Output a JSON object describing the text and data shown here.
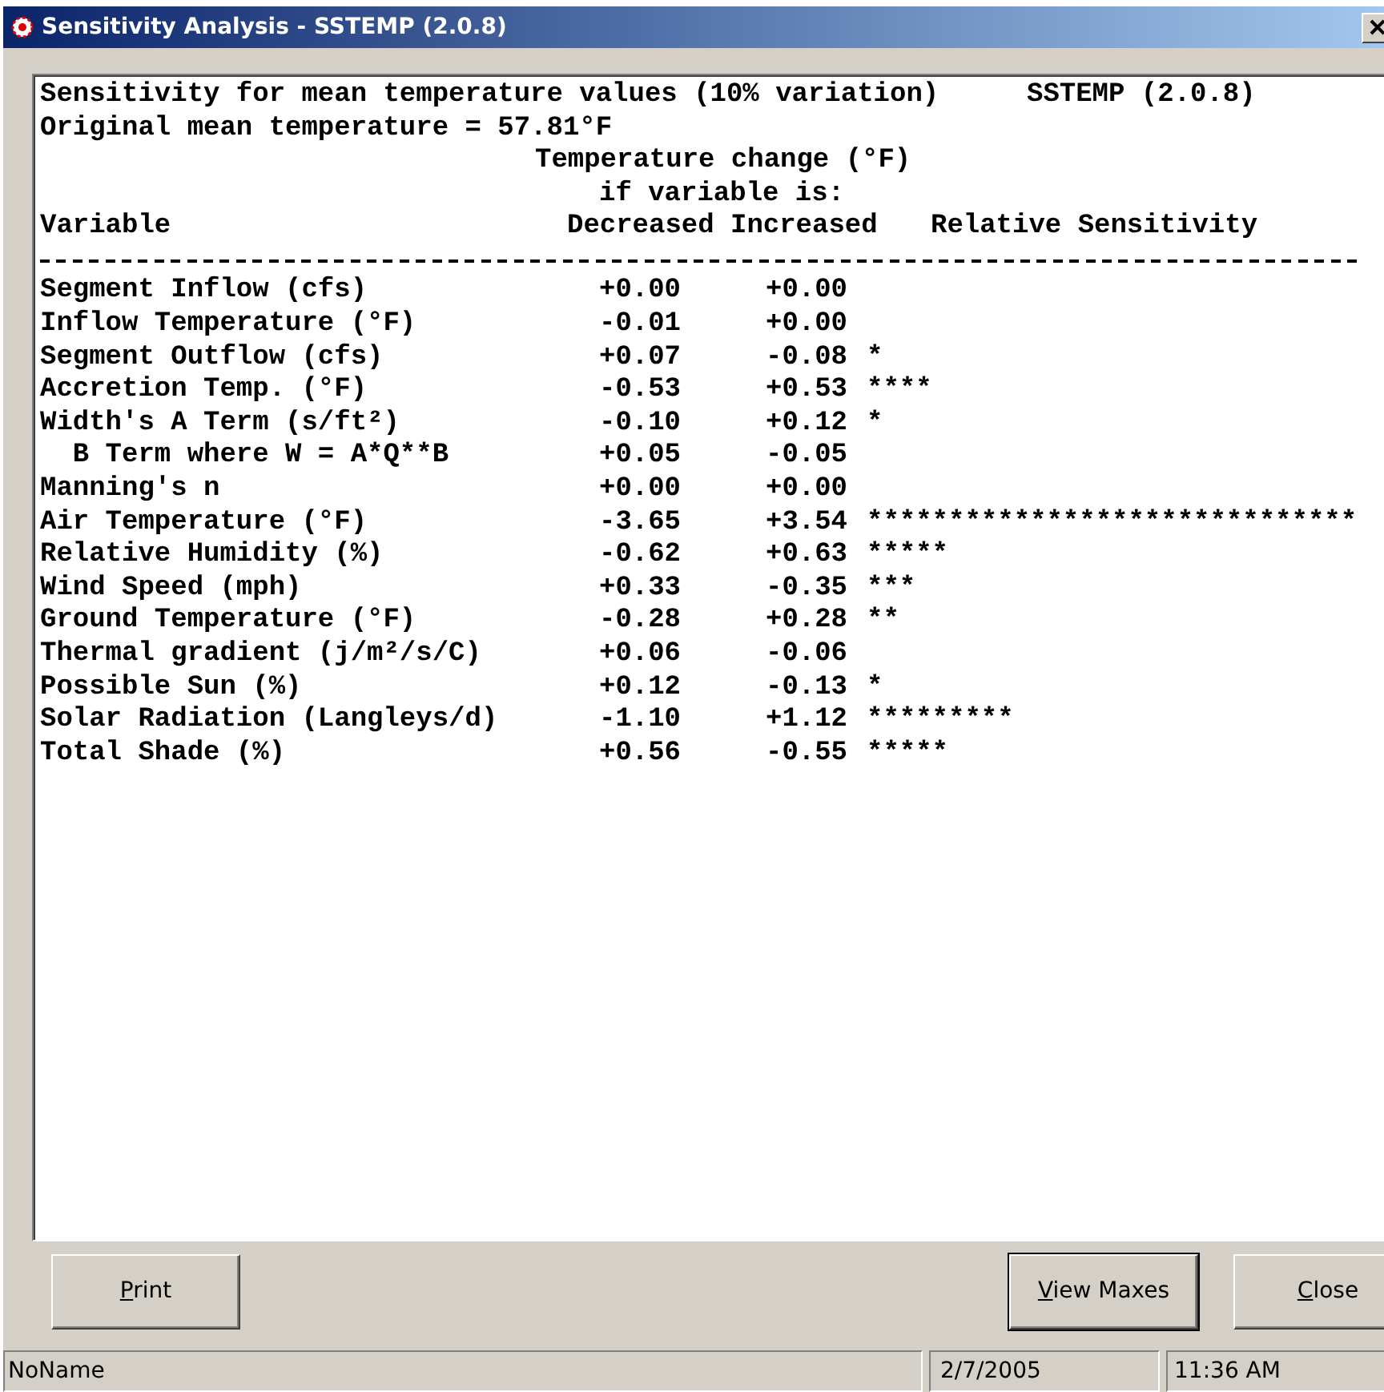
{
  "window": {
    "title": "Sensitivity Analysis - SSTEMP (2.0.8)"
  },
  "report": {
    "title": "Sensitivity for mean temperature values (10% variation)",
    "version": "SSTEMP (2.0.8)",
    "original": "Original mean temperature = 57.81°F",
    "group_heading": "Temperature change (°F)",
    "group_subheading": "if variable is:",
    "columns": [
      "Variable",
      "Decreased",
      "Increased",
      "Relative Sensitivity"
    ],
    "rows": [
      {
        "variable": "Segment Inflow (cfs)",
        "decreased": "+0.00",
        "increased": "+0.00",
        "sensitivity": ""
      },
      {
        "variable": "Inflow Temperature (°F)",
        "decreased": "-0.01",
        "increased": "+0.00",
        "sensitivity": ""
      },
      {
        "variable": "Segment Outflow (cfs)",
        "decreased": "+0.07",
        "increased": "-0.08",
        "sensitivity": "*"
      },
      {
        "variable": "Accretion Temp. (°F)",
        "decreased": "-0.53",
        "increased": "+0.53",
        "sensitivity": "****"
      },
      {
        "variable": "Width's A Term (s/ft²)",
        "decreased": "-0.10",
        "increased": "+0.12",
        "sensitivity": "*"
      },
      {
        "variable": "  B Term where W = A*Q**B",
        "decreased": "+0.05",
        "increased": "-0.05",
        "sensitivity": ""
      },
      {
        "variable": "Manning's n",
        "decreased": "+0.00",
        "increased": "+0.00",
        "sensitivity": ""
      },
      {
        "variable": "Air Temperature (°F)",
        "decreased": "-3.65",
        "increased": "+3.54",
        "sensitivity": "******************************"
      },
      {
        "variable": "Relative Humidity (%)",
        "decreased": "-0.62",
        "increased": "+0.63",
        "sensitivity": "*****"
      },
      {
        "variable": "Wind Speed (mph)",
        "decreased": "+0.33",
        "increased": "-0.35",
        "sensitivity": "***"
      },
      {
        "variable": "Ground Temperature (°F)",
        "decreased": "-0.28",
        "increased": "+0.28",
        "sensitivity": "**"
      },
      {
        "variable": "Thermal gradient (j/m²/s/C)",
        "decreased": "+0.06",
        "increased": "-0.06",
        "sensitivity": ""
      },
      {
        "variable": "Possible Sun (%)",
        "decreased": "+0.12",
        "increased": "-0.13",
        "sensitivity": "*"
      },
      {
        "variable": "Solar Radiation (Langleys/d)",
        "decreased": "-1.10",
        "increased": "+1.12",
        "sensitivity": "*********"
      },
      {
        "variable": "Total Shade (%)",
        "decreased": "+0.56",
        "increased": "-0.55",
        "sensitivity": "*****"
      }
    ]
  },
  "buttons": [
    {
      "label": "Print",
      "default": false
    },
    {
      "label": "View Maxes",
      "default": true
    },
    {
      "label": "Close",
      "default": false
    }
  ],
  "status_bar": [
    "NoName",
    "2/7/2005",
    "11:36 AM"
  ]
}
